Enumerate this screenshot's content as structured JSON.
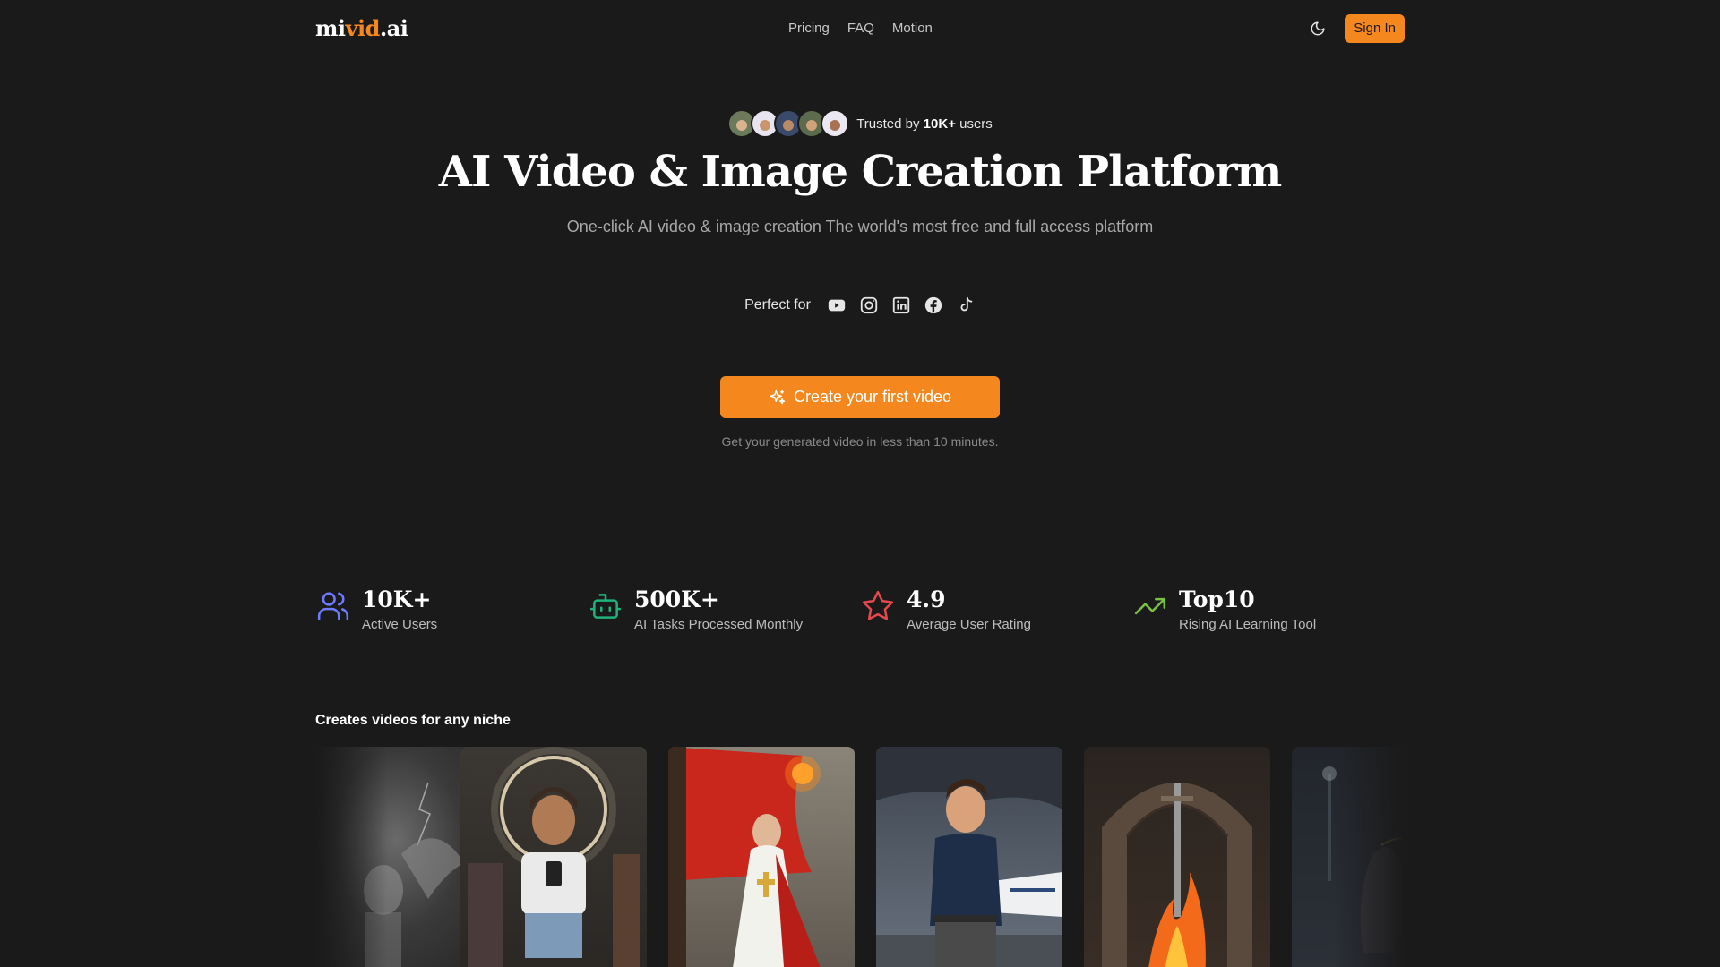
{
  "header": {
    "logo": {
      "part1": "mi",
      "part2": "vid",
      "part3": ".ai"
    },
    "nav": [
      {
        "label": "Pricing"
      },
      {
        "label": "FAQ"
      },
      {
        "label": "Motion"
      }
    ],
    "sign_in_label": "Sign In"
  },
  "hero": {
    "trusted_prefix": "Trusted by",
    "trusted_count": "10K+",
    "trusted_suffix": "users",
    "title": "AI Video & Image Creation Platform",
    "subtitle": "One-click AI video & image creation The world's most free and full access platform",
    "perfect_for_label": "Perfect for",
    "socials": [
      "youtube-icon",
      "instagram-icon",
      "linkedin-icon",
      "facebook-icon",
      "tiktok-icon"
    ],
    "cta_label": "Create your first video",
    "cta_note": "Get your generated video in less than 10 minutes."
  },
  "stats": [
    {
      "value": "10K+",
      "label": "Active Users",
      "icon": "users-icon",
      "color": "#6c7bff"
    },
    {
      "value": "500K+",
      "label": "AI Tasks Processed Monthly",
      "icon": "robot-icon",
      "color": "#1fb37a"
    },
    {
      "value": "4.9",
      "label": "Average User Rating",
      "icon": "star-icon",
      "color": "#e5484d"
    },
    {
      "value": "Top10",
      "label": "Rising AI Learning Tool",
      "icon": "trending-up-icon",
      "color": "#7bc043"
    }
  ],
  "niche": {
    "title": "Creates videos for any niche"
  },
  "colors": {
    "background": "#1a1a1a",
    "accent": "#f5871f"
  }
}
